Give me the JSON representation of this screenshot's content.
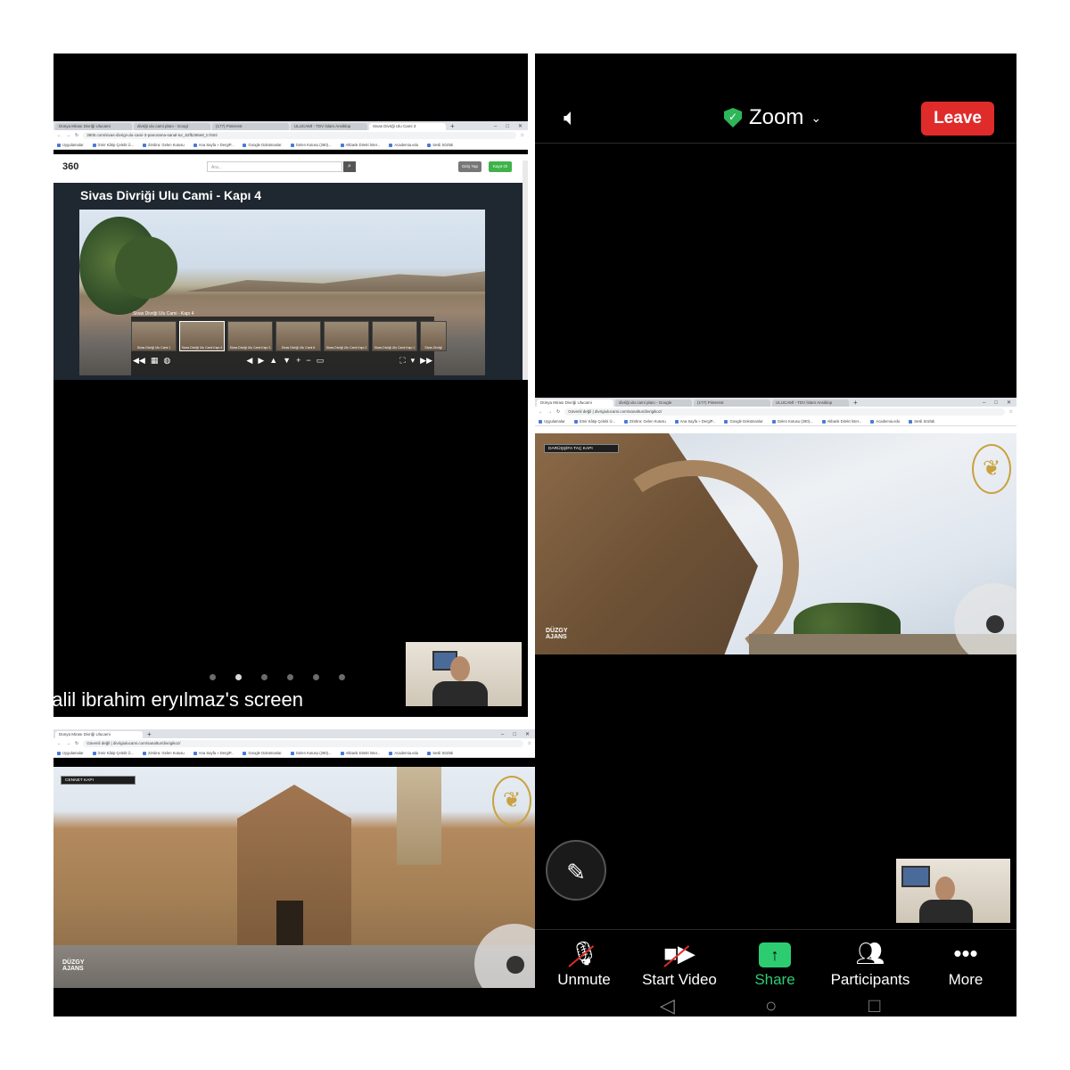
{
  "tl": {
    "tabs": [
      "Dünya Mirası Divriği Ulucami",
      "divriği ulu cami planı - Googl",
      "(177) Pinterest",
      "ULUCAMİ - TDV İslam Ansiklop",
      "Sivas Divriği Ulu Cami 3"
    ],
    "url": "360tr.com/sivas-divrigi-ulu-cami-3-panorama-sanal-tur_62fb266e8_tr.html",
    "bookmarks": [
      "Uygulamalar",
      "İzmir Kâtip Çelebi Ü...",
      "Zimbra: Gelen Kutusu",
      "Ana Sayfa » DergiP...",
      "Google Dokümanlar",
      "Gelen Kutusu (280)...",
      "Akbank Direkt İnter...",
      "Academia.edu",
      "Sesli Sözlük"
    ],
    "logo": "360",
    "search_placeholder": "Ara...",
    "btn1": "Giriş Yap",
    "btn2": "Kayıt Ol",
    "page_title": "Sivas Divriği Ulu Cami - Kapı 4",
    "pano_caption": "Sivas Divriği Ulu Cami - Kapı 4",
    "thumbs": [
      "Sivas Divriği Ulu Cami 1",
      "Sivas Divriği Ulu Cami Kapı 4",
      "Sivas Divriği Ulu Cami Kapı 3",
      "Sivas Divriği Ulu Cami 6",
      "Sivas Divriği Ulu Cami Kapı 2",
      "Sivas Divriği Ulu Cami Kapı 1",
      "Sivas Divriği"
    ],
    "screen_label": "halil ibrahim eryılmaz's screen"
  },
  "bl": {
    "tabs": [
      "Dünya Mirası Divriği Ulucami"
    ],
    "url": "Güvenli değil | divrigiulucami.com/sanaltur/divrigikoz/",
    "bookmarks": [
      "Uygulamalar",
      "İzmir Kâtip Çelebi Ü...",
      "Zimbra: Gelen Kutusu",
      "Ana Sayfa » DergiP...",
      "Google Dokümanlar",
      "Gelen Kutusu (280)...",
      "Akbank Direkt İnter...",
      "Academia.edu",
      "Sesli Sözlük"
    ],
    "dropdown": "CENNET KAPI",
    "agency_line1": "DÜZGY",
    "agency_line2": "AJANS"
  },
  "r": {
    "app_title": "Zoom",
    "leave": "Leave",
    "tabs": [
      "Dünya Mirası Divriği Ulucami",
      "divriği ulu cami planı - Google",
      "(177) Pinterest",
      "ULUCAMİ - TDV İslam Ansiklop"
    ],
    "url": "Güvenli değil | divrigiulucami.com/sanaltur/divrigikoz/",
    "bookmarks": [
      "Uygulamalar",
      "İzmir Kâtip Çelebi Ü...",
      "Zimbra: Gelen Kutusu",
      "Ana Sayfa » DergiP...",
      "Google Dokümanlar",
      "Gelen Kutusu (280)...",
      "Akbank Direkt İnter...",
      "Academia.edu",
      "Sesli Sözlük"
    ],
    "dropdown": "DARÜŞŞİFA TAÇ KAPI",
    "agency_line1": "DÜZGY",
    "agency_line2": "AJANS",
    "toolbar": {
      "unmute": "Unmute",
      "start_video": "Start Video",
      "share": "Share",
      "participants": "Participants",
      "more": "More"
    }
  },
  "colors": {
    "leave": "#e02b2b",
    "share": "#2ecc71",
    "secure_shield": "#2fb55a",
    "background": "#000000"
  },
  "icons": [
    "speaker-icon",
    "shield-check-icon",
    "chevron-down-icon",
    "pencil-icon",
    "mic-muted-icon",
    "video-off-icon",
    "share-arrow-icon",
    "participants-icon",
    "more-icon"
  ]
}
